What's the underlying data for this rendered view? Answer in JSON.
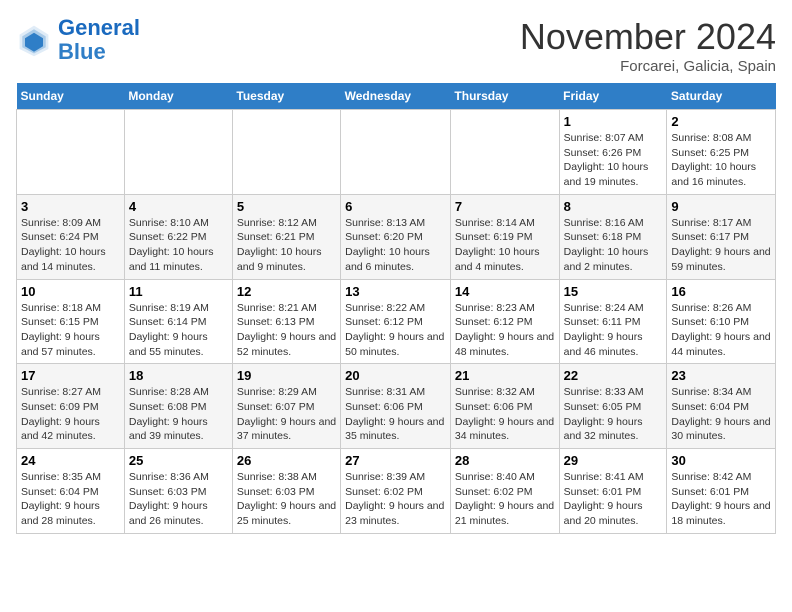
{
  "logo": {
    "general": "General",
    "blue": "Blue"
  },
  "header": {
    "month_year": "November 2024",
    "location": "Forcarei, Galicia, Spain"
  },
  "weekdays": [
    "Sunday",
    "Monday",
    "Tuesday",
    "Wednesday",
    "Thursday",
    "Friday",
    "Saturday"
  ],
  "weeks": [
    [
      {
        "day": "",
        "info": ""
      },
      {
        "day": "",
        "info": ""
      },
      {
        "day": "",
        "info": ""
      },
      {
        "day": "",
        "info": ""
      },
      {
        "day": "",
        "info": ""
      },
      {
        "day": "1",
        "info": "Sunrise: 8:07 AM\nSunset: 6:26 PM\nDaylight: 10 hours and 19 minutes."
      },
      {
        "day": "2",
        "info": "Sunrise: 8:08 AM\nSunset: 6:25 PM\nDaylight: 10 hours and 16 minutes."
      }
    ],
    [
      {
        "day": "3",
        "info": "Sunrise: 8:09 AM\nSunset: 6:24 PM\nDaylight: 10 hours and 14 minutes."
      },
      {
        "day": "4",
        "info": "Sunrise: 8:10 AM\nSunset: 6:22 PM\nDaylight: 10 hours and 11 minutes."
      },
      {
        "day": "5",
        "info": "Sunrise: 8:12 AM\nSunset: 6:21 PM\nDaylight: 10 hours and 9 minutes."
      },
      {
        "day": "6",
        "info": "Sunrise: 8:13 AM\nSunset: 6:20 PM\nDaylight: 10 hours and 6 minutes."
      },
      {
        "day": "7",
        "info": "Sunrise: 8:14 AM\nSunset: 6:19 PM\nDaylight: 10 hours and 4 minutes."
      },
      {
        "day": "8",
        "info": "Sunrise: 8:16 AM\nSunset: 6:18 PM\nDaylight: 10 hours and 2 minutes."
      },
      {
        "day": "9",
        "info": "Sunrise: 8:17 AM\nSunset: 6:17 PM\nDaylight: 9 hours and 59 minutes."
      }
    ],
    [
      {
        "day": "10",
        "info": "Sunrise: 8:18 AM\nSunset: 6:15 PM\nDaylight: 9 hours and 57 minutes."
      },
      {
        "day": "11",
        "info": "Sunrise: 8:19 AM\nSunset: 6:14 PM\nDaylight: 9 hours and 55 minutes."
      },
      {
        "day": "12",
        "info": "Sunrise: 8:21 AM\nSunset: 6:13 PM\nDaylight: 9 hours and 52 minutes."
      },
      {
        "day": "13",
        "info": "Sunrise: 8:22 AM\nSunset: 6:12 PM\nDaylight: 9 hours and 50 minutes."
      },
      {
        "day": "14",
        "info": "Sunrise: 8:23 AM\nSunset: 6:12 PM\nDaylight: 9 hours and 48 minutes."
      },
      {
        "day": "15",
        "info": "Sunrise: 8:24 AM\nSunset: 6:11 PM\nDaylight: 9 hours and 46 minutes."
      },
      {
        "day": "16",
        "info": "Sunrise: 8:26 AM\nSunset: 6:10 PM\nDaylight: 9 hours and 44 minutes."
      }
    ],
    [
      {
        "day": "17",
        "info": "Sunrise: 8:27 AM\nSunset: 6:09 PM\nDaylight: 9 hours and 42 minutes."
      },
      {
        "day": "18",
        "info": "Sunrise: 8:28 AM\nSunset: 6:08 PM\nDaylight: 9 hours and 39 minutes."
      },
      {
        "day": "19",
        "info": "Sunrise: 8:29 AM\nSunset: 6:07 PM\nDaylight: 9 hours and 37 minutes."
      },
      {
        "day": "20",
        "info": "Sunrise: 8:31 AM\nSunset: 6:06 PM\nDaylight: 9 hours and 35 minutes."
      },
      {
        "day": "21",
        "info": "Sunrise: 8:32 AM\nSunset: 6:06 PM\nDaylight: 9 hours and 34 minutes."
      },
      {
        "day": "22",
        "info": "Sunrise: 8:33 AM\nSunset: 6:05 PM\nDaylight: 9 hours and 32 minutes."
      },
      {
        "day": "23",
        "info": "Sunrise: 8:34 AM\nSunset: 6:04 PM\nDaylight: 9 hours and 30 minutes."
      }
    ],
    [
      {
        "day": "24",
        "info": "Sunrise: 8:35 AM\nSunset: 6:04 PM\nDaylight: 9 hours and 28 minutes."
      },
      {
        "day": "25",
        "info": "Sunrise: 8:36 AM\nSunset: 6:03 PM\nDaylight: 9 hours and 26 minutes."
      },
      {
        "day": "26",
        "info": "Sunrise: 8:38 AM\nSunset: 6:03 PM\nDaylight: 9 hours and 25 minutes."
      },
      {
        "day": "27",
        "info": "Sunrise: 8:39 AM\nSunset: 6:02 PM\nDaylight: 9 hours and 23 minutes."
      },
      {
        "day": "28",
        "info": "Sunrise: 8:40 AM\nSunset: 6:02 PM\nDaylight: 9 hours and 21 minutes."
      },
      {
        "day": "29",
        "info": "Sunrise: 8:41 AM\nSunset: 6:01 PM\nDaylight: 9 hours and 20 minutes."
      },
      {
        "day": "30",
        "info": "Sunrise: 8:42 AM\nSunset: 6:01 PM\nDaylight: 9 hours and 18 minutes."
      }
    ]
  ]
}
